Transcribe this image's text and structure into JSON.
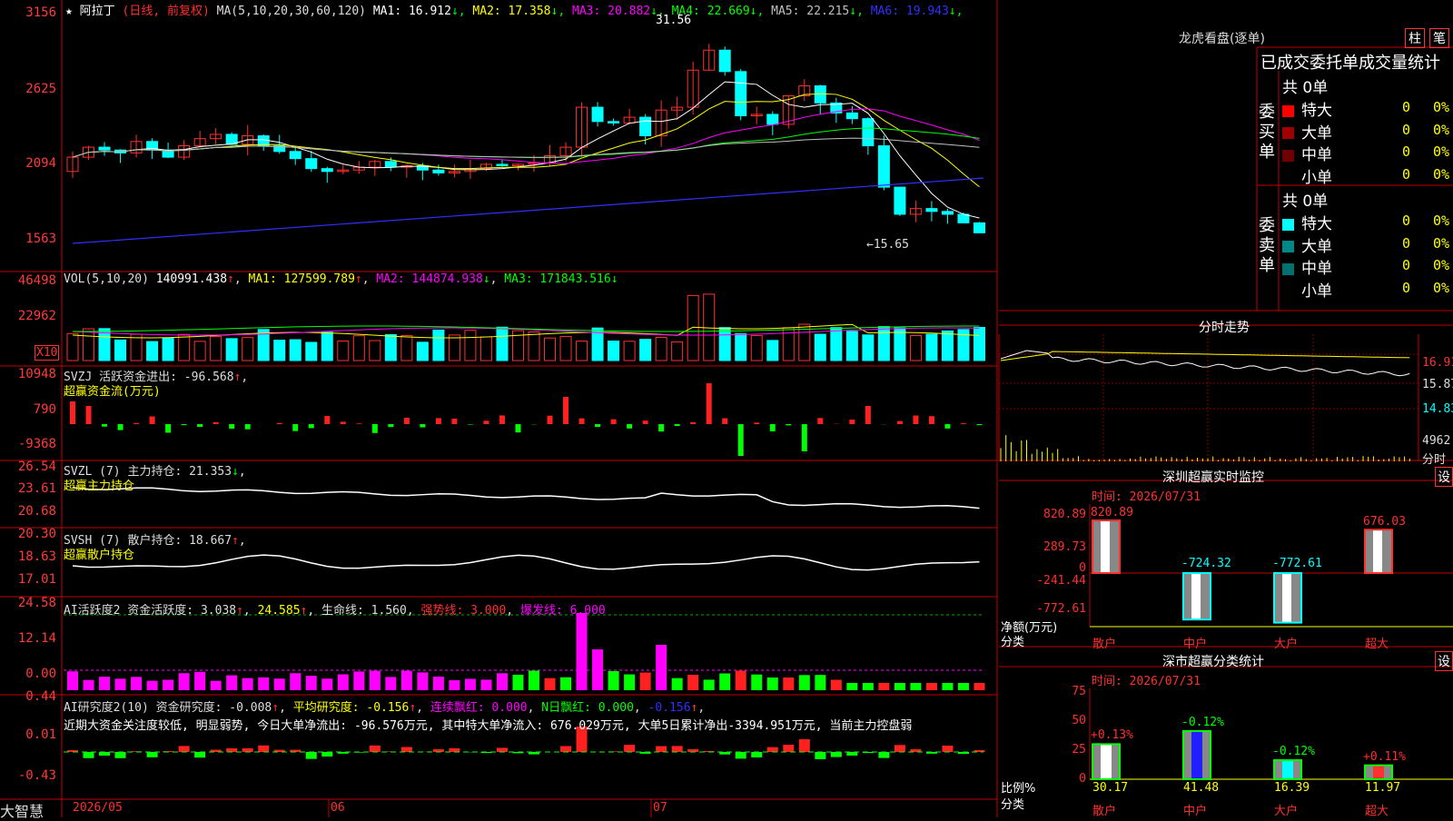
{
  "main": {
    "star": "★",
    "stock_name": "阿拉丁",
    "period": "(日线, 前复权)",
    "ma_params": "MA(5,10,20,30,60,120)",
    "ma_values": [
      {
        "label": "MA1: 16.912",
        "arrow": "↓",
        "color": "#ffffff"
      },
      {
        "label": "MA2: 17.358",
        "arrow": "↓",
        "color": "#ffff00"
      },
      {
        "label": "MA3: 20.882",
        "arrow": "↓",
        "color": "#ff00ff"
      },
      {
        "label": "MA4: 22.669",
        "arrow": "↓",
        "color": "#00ff00"
      },
      {
        "label": "MA5: 22.215",
        "arrow": "↓",
        "color": "#c0c0c0"
      },
      {
        "label": "MA6: 19.943",
        "arrow": "↓",
        "color": "#3030ff"
      }
    ],
    "y_labels": [
      "3156",
      "2625",
      "2094",
      "1563"
    ],
    "high_marker": "31.56",
    "low_marker": "←15.65"
  },
  "vol": {
    "params": "VOL(5,10,20)",
    "value": "140991.438",
    "ma1": "MA1: 127599.789",
    "ma2": "MA2: 144874.938",
    "ma3": "MA3: 171843.516",
    "y_labels": [
      "46498",
      "22962"
    ],
    "unit": "X10"
  },
  "svzj": {
    "title": "SVZJ  活跃资金进出: -96.568",
    "subtitle": "超赢资金流(万元)",
    "y_labels": [
      "10948",
      "790",
      "-9368"
    ]
  },
  "svzl": {
    "title": "SVZL (7) 主力持仓: 21.353",
    "subtitle": "超赢主力持仓",
    "y_labels": [
      "26.54",
      "23.61",
      "20.68"
    ]
  },
  "svsh": {
    "title": "SVSH (7) 散户持仓: 18.667",
    "subtitle": "超赢散户持仓",
    "y_labels": [
      "20.30",
      "18.63",
      "17.01"
    ]
  },
  "ai_active": {
    "title": "AI活跃度2 资金活跃度: 3.038",
    "v2": "24.585",
    "life": "生命线: 1.560",
    "strong": "强势线: 3.000",
    "burst": "爆发线: 6.000",
    "y_labels": [
      "24.58",
      "12.14",
      "0.00"
    ]
  },
  "ai_research": {
    "title": "AI研究度2(10) 资金研究度: -0.008",
    "avg": "平均研究度: -0.156",
    "red": "连续飘红: 0.000",
    "nred": "N日飘红: 0.000",
    "last": "-0.156",
    "comment": "近期大资金关注度较低, 明显弱势, 今日大单净流出: -96.576万元, 其中特大单净流入: 676.029万元, 大单5日累计净出-3394.951万元, 当前主力控盘弱",
    "y_labels": [
      "0.44",
      "0.01",
      "-0.43"
    ]
  },
  "bottom": {
    "brand": "大智慧",
    "dates": [
      "2026/05",
      "06",
      "07"
    ]
  },
  "right": {
    "lhb_title": "龙虎看盘(逐单)",
    "tab_zhu": "柱",
    "tab_bi": "笔",
    "table_header": "已成交委托单成交量统计",
    "buy_label": "委买单",
    "sell_label": "委卖单",
    "buy_total": "共 0单",
    "sell_total": "共 0单",
    "buy_rows": [
      {
        "name": "特大",
        "count": "0",
        "pct": "0%",
        "color": "#ff0000"
      },
      {
        "name": "大单",
        "count": "0",
        "pct": "0%",
        "color": "#a00000"
      },
      {
        "name": "中单",
        "count": "0",
        "pct": "0%",
        "color": "#700000"
      },
      {
        "name": "小单",
        "count": "0",
        "pct": "0%",
        "color": ""
      }
    ],
    "sell_rows": [
      {
        "name": "特大",
        "count": "0",
        "pct": "0%",
        "color": "#00ffff"
      },
      {
        "name": "大单",
        "count": "0",
        "pct": "0%",
        "color": "#008888"
      },
      {
        "name": "中单",
        "count": "0",
        "pct": "0%",
        "color": "#007070"
      },
      {
        "name": "小单",
        "count": "0",
        "pct": "0%",
        "color": ""
      }
    ],
    "intraday_title": "分时走势",
    "intraday_labels": [
      "16.91",
      "15.87",
      "14.83"
    ],
    "intraday_vol": "4962",
    "intraday_unit": "分时",
    "sz_title": "深圳超赢实时监控",
    "set_label": "设",
    "sz_time": "时间: 2026/07/31",
    "sz_y": [
      "820.89",
      "289.73",
      "0",
      "-241.44",
      "-772.61"
    ],
    "sz_bars": [
      {
        "cat": "散户",
        "value": 820.89,
        "label": "820.89"
      },
      {
        "cat": "中户",
        "value": -724.32,
        "label": "-724.32"
      },
      {
        "cat": "大户",
        "value": -772.61,
        "label": "-772.61"
      },
      {
        "cat": "超大",
        "value": 676.03,
        "label": "676.03"
      }
    ],
    "sz_axis1": "净额(万元)",
    "sz_axis2": "分类",
    "cls_title": "深市超赢分类统计",
    "cls_time": "时间: 2026/07/31",
    "cls_y": [
      "75",
      "50",
      "25",
      "0"
    ],
    "cls_bars": [
      {
        "cat": "散户",
        "value": 30.17,
        "label": "30.17",
        "pct": "+0.13%",
        "color": "#ffffff"
      },
      {
        "cat": "中户",
        "value": 41.48,
        "label": "41.48",
        "pct": "-0.12%",
        "color": "#2020ff"
      },
      {
        "cat": "大户",
        "value": 16.39,
        "label": "16.39",
        "pct": "-0.12%",
        "color": "#00ffff"
      },
      {
        "cat": "超大",
        "value": 11.97,
        "label": "11.97",
        "pct": "+0.11%",
        "color": "#ff3030"
      }
    ],
    "cls_axis1": "比例%",
    "cls_axis2": "分类"
  }
}
